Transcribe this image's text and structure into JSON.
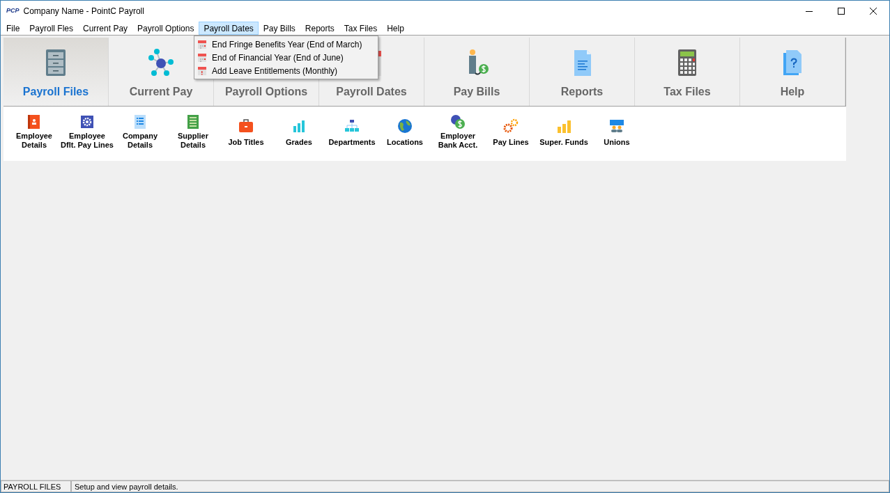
{
  "window": {
    "logo": "PCP",
    "title": "Company Name - PointC Payroll"
  },
  "menu_bar": [
    {
      "label": "File",
      "selected": false
    },
    {
      "label": "Payroll Fles",
      "selected": false
    },
    {
      "label": "Current Pay",
      "selected": false
    },
    {
      "label": "Payroll Options",
      "selected": false
    },
    {
      "label": "Payroll Dates",
      "selected": true
    },
    {
      "label": "Pay Bills",
      "selected": false
    },
    {
      "label": "Reports",
      "selected": false
    },
    {
      "label": "Tax Files",
      "selected": false
    },
    {
      "label": "Help",
      "selected": false
    }
  ],
  "dropdown": [
    {
      "label": "End Fringe Benefits Year (End of March)"
    },
    {
      "label": "End of Financial Year (End of June)"
    },
    {
      "label": "Add Leave Entitlements (Monthly)"
    }
  ],
  "ribbon_tabs": [
    {
      "label": "Payroll Files",
      "selected": true
    },
    {
      "label": "Current Pay",
      "selected": false
    },
    {
      "label": "Payroll Options",
      "selected": false
    },
    {
      "label": "Payroll Dates",
      "selected": false
    },
    {
      "label": "Pay Bills",
      "selected": false
    },
    {
      "label": "Reports",
      "selected": false
    },
    {
      "label": "Tax Files",
      "selected": false
    },
    {
      "label": "Help",
      "selected": false
    }
  ],
  "tools": [
    {
      "lines": [
        "Employee",
        "Details"
      ]
    },
    {
      "lines": [
        "Employee",
        "Dflt. Pay Lines"
      ]
    },
    {
      "lines": [
        "Company",
        "Details"
      ]
    },
    {
      "lines": [
        "Supplier",
        "Details"
      ]
    },
    {
      "lines": [
        "Job Titles"
      ]
    },
    {
      "lines": [
        "Grades"
      ]
    },
    {
      "lines": [
        "Departments"
      ]
    },
    {
      "lines": [
        "Locations"
      ]
    },
    {
      "lines": [
        "Employer",
        "Bank Acct."
      ]
    },
    {
      "lines": [
        "Pay Lines"
      ]
    },
    {
      "lines": [
        "Super. Funds"
      ]
    },
    {
      "lines": [
        "Unions"
      ]
    }
  ],
  "status_bar": {
    "section": "PAYROLL FILES",
    "message": "Setup and view payroll details."
  }
}
